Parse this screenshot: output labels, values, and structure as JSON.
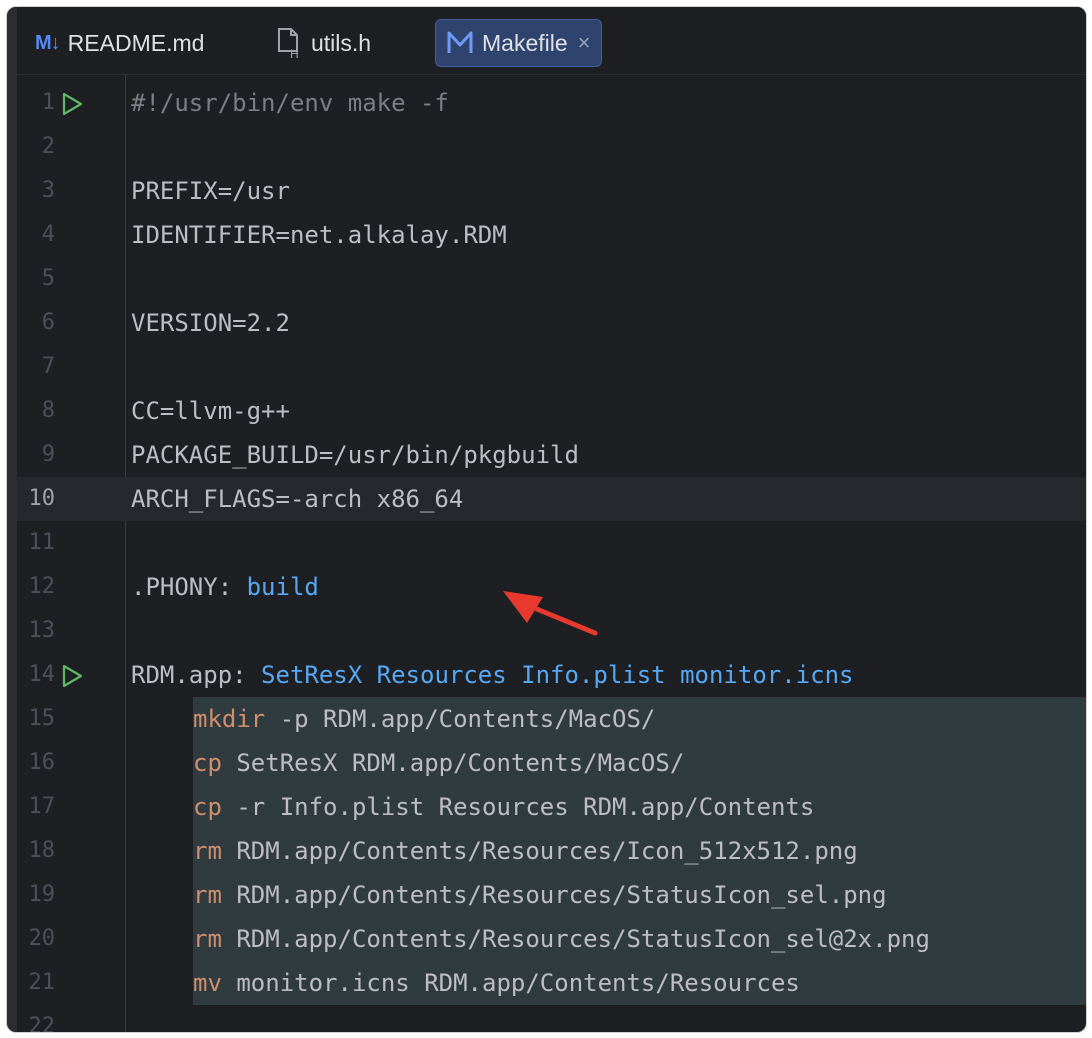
{
  "tabs": [
    {
      "label": "README.md",
      "icon": "markdown-icon",
      "icon_text": "M↓",
      "active": false
    },
    {
      "label": "utils.h",
      "icon": "header-file-icon",
      "active": false
    },
    {
      "label": "Makefile",
      "icon": "makefile-icon",
      "active": true,
      "close_glyph": "×"
    }
  ],
  "editor": {
    "current_line": 10,
    "lines": [
      {
        "num": "1",
        "parts": [
          {
            "t": "#!/usr/bin/env make -f",
            "k": "comment"
          }
        ],
        "run": true
      },
      {
        "num": "2",
        "parts": []
      },
      {
        "num": "3",
        "parts": [
          {
            "t": "PREFIX=/usr",
            "k": "plain"
          }
        ]
      },
      {
        "num": "4",
        "parts": [
          {
            "t": "IDENTIFIER=net.alkalay.RDM",
            "k": "plain"
          }
        ]
      },
      {
        "num": "5",
        "parts": []
      },
      {
        "num": "6",
        "parts": [
          {
            "t": "VERSION=2.2",
            "k": "plain"
          }
        ]
      },
      {
        "num": "7",
        "parts": []
      },
      {
        "num": "8",
        "parts": [
          {
            "t": "CC=llvm-g++",
            "k": "plain"
          }
        ]
      },
      {
        "num": "9",
        "parts": [
          {
            "t": "PACKAGE_BUILD=/usr/bin/pkgbuild",
            "k": "plain"
          }
        ]
      },
      {
        "num": "10",
        "parts": [
          {
            "t": "ARCH_FLAGS=-arch x86_64",
            "k": "plain"
          }
        ]
      },
      {
        "num": "11",
        "parts": []
      },
      {
        "num": "12",
        "parts": [
          {
            "t": ".PHONY: ",
            "k": "plain"
          },
          {
            "t": "build",
            "k": "target"
          }
        ]
      },
      {
        "num": "13",
        "parts": []
      },
      {
        "num": "14",
        "parts": [
          {
            "t": "RDM.app: ",
            "k": "plain"
          },
          {
            "t": "SetResX Resources Info.plist monitor.icns",
            "k": "target"
          }
        ],
        "run": true
      },
      {
        "num": "15",
        "recipe": true,
        "parts": [
          {
            "t": "mkdir",
            "k": "cmd"
          },
          {
            "t": " -p RDM.app/Contents/MacOS/",
            "k": "plain"
          }
        ]
      },
      {
        "num": "16",
        "recipe": true,
        "parts": [
          {
            "t": "cp",
            "k": "cmd"
          },
          {
            "t": " SetResX RDM.app/Contents/MacOS/",
            "k": "plain"
          }
        ]
      },
      {
        "num": "17",
        "recipe": true,
        "parts": [
          {
            "t": "cp",
            "k": "cmd"
          },
          {
            "t": " -r Info.plist Resources RDM.app/Contents",
            "k": "plain"
          }
        ]
      },
      {
        "num": "18",
        "recipe": true,
        "parts": [
          {
            "t": "rm",
            "k": "cmd"
          },
          {
            "t": " RDM.app/Contents/Resources/Icon_512x512.png",
            "k": "plain"
          }
        ]
      },
      {
        "num": "19",
        "recipe": true,
        "parts": [
          {
            "t": "rm",
            "k": "cmd"
          },
          {
            "t": " RDM.app/Contents/Resources/StatusIcon_sel.png",
            "k": "plain"
          }
        ]
      },
      {
        "num": "20",
        "recipe": true,
        "parts": [
          {
            "t": "rm",
            "k": "cmd"
          },
          {
            "t": " RDM.app/Contents/Resources/StatusIcon_sel@2x.png",
            "k": "plain"
          }
        ]
      },
      {
        "num": "21",
        "recipe": true,
        "parts": [
          {
            "t": "mv",
            "k": "cmd"
          },
          {
            "t": " monitor.icns RDM.app/Contents/Resources",
            "k": "plain"
          }
        ]
      },
      {
        "num": "22",
        "parts": []
      }
    ]
  },
  "colors": {
    "background": "#1e1f22",
    "recipe_highlight": "#2f3b3e",
    "active_tab": "#2e436e",
    "target_blue": "#56a8f5",
    "command_orange": "#cf8e6d",
    "run_green": "#5fb865",
    "annotation_arrow": "#e8392f"
  }
}
